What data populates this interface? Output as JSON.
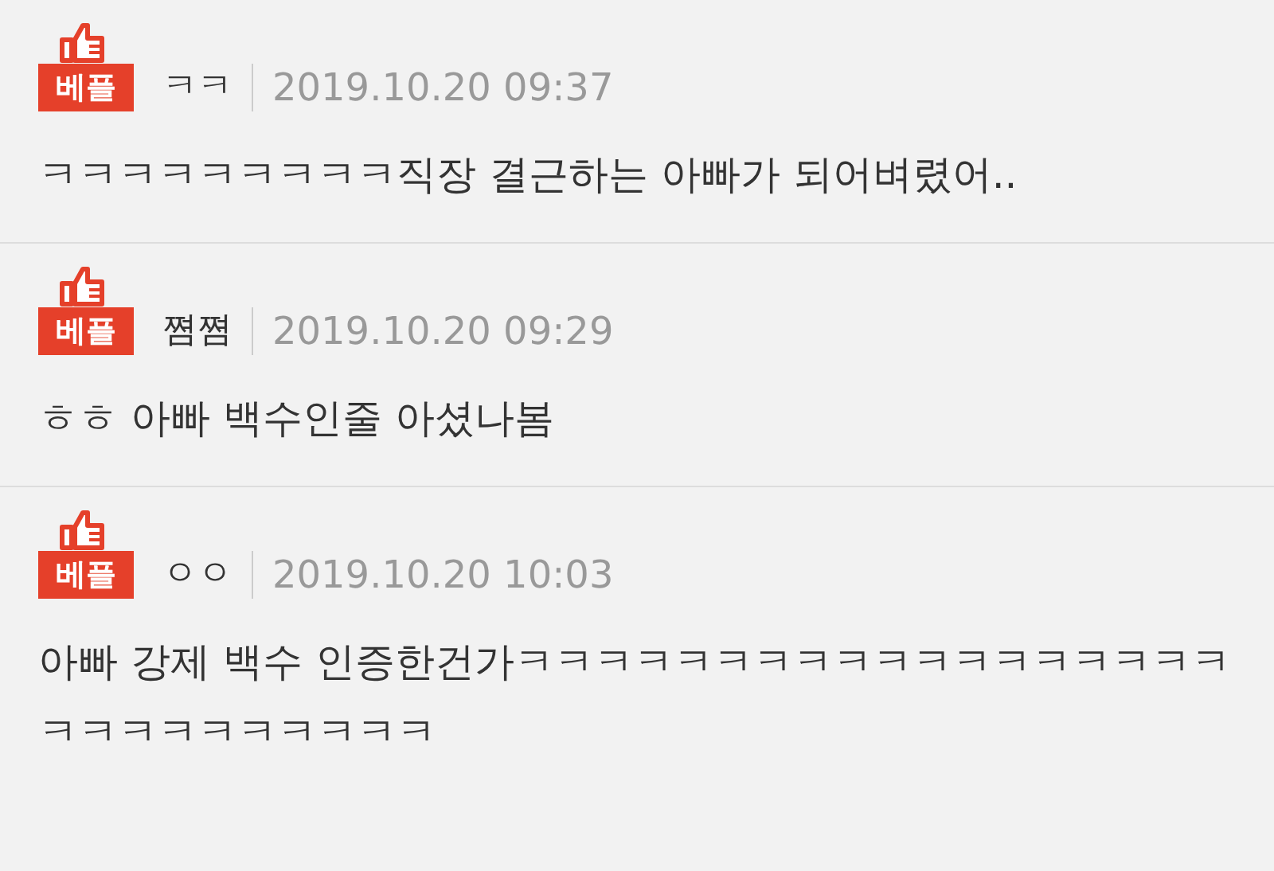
{
  "comments": [
    {
      "badge": "베플",
      "author": "ㅋㅋ",
      "date": "2019.10.20 09:37",
      "text": "ㅋㅋㅋㅋㅋㅋㅋㅋㅋ직장 결근하는 아빠가 되어벼렸어.."
    },
    {
      "badge": "베플",
      "author": "쪔쪔",
      "date": "2019.10.20 09:29",
      "text": "ㅎㅎ 아빠 백수인줄 아셨나봄"
    },
    {
      "badge": "베플",
      "author": "ㅇㅇ",
      "date": "2019.10.20 10:03",
      "text": "아빠 강제 백수 인증한건가ㅋㅋㅋㅋㅋㅋㅋㅋㅋㅋㅋㅋㅋㅋㅋㅋㅋㅋㅋㅋㅋㅋㅋㅋㅋㅋㅋㅋ"
    }
  ]
}
